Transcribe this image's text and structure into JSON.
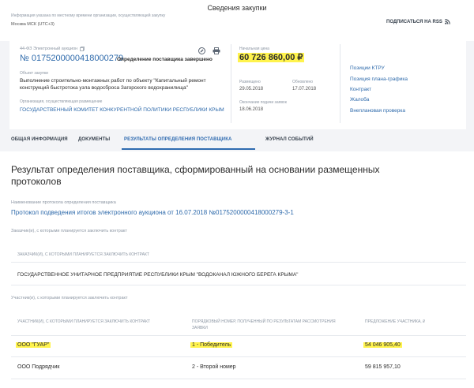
{
  "header": {
    "title": "Сведения закупки",
    "notice": "Информация указана по местному времени организации, осуществляющей закупку",
    "timezone": "Москва МСК (UTC+3)",
    "rss": "ПОДПИСАТЬСЯ НА RSS"
  },
  "procurement": {
    "law": "44-ФЗ Электронный аукцион",
    "number": "№ 0175200000418000279",
    "status": "Определение поставщика завершено",
    "object_label": "Объект закупки",
    "object_line1": "Выполнение строительно-монтажных работ по объекту \"Капитальный ремонт",
    "object_line2": "конструкций быстротока узла водосброса Загорского водохранилища\"",
    "org_label": "Организация, осуществляющая размещение",
    "org_name": "ГОСУДАРСТВЕННЫЙ КОМИТЕТ КОНКУРЕНТНОЙ ПОЛИТИКИ РЕСПУБЛИКИ КРЫМ",
    "price_label": "Начальная цена",
    "price": "60 726 860,00 ₽",
    "posted_label": "Размещено",
    "posted": "29.05.2018",
    "updated_label": "Обновлено",
    "updated": "17.07.2018",
    "deadline_label": "Окончание подачи заявок",
    "deadline": "18.06.2018"
  },
  "sidelinks": [
    "Позиции КТРУ",
    "Позиция плана-графика",
    "Контракт",
    "Жалоба",
    "Внеплановая проверка"
  ],
  "tabs": [
    "ОБЩАЯ ИНФОРМАЦИЯ",
    "ДОКУМЕНТЫ",
    "РЕЗУЛЬТАТЫ ОПРЕДЕЛЕНИЯ ПОСТАВЩИКА",
    "ЖУРНАЛ СОБЫТИЙ"
  ],
  "result": {
    "title_line1": "Результат определения поставщика, сформированный на основании размещенных",
    "title_line2": "протоколов",
    "protocol_label": "Наименование протокола определения поставщика",
    "protocol": "Протокол подведения итогов электронного аукциона от 16.07.2018 №0175200000418000279-3-1",
    "customers_label": "Заказчик(и), с которыми планируется заключить контракт",
    "customers_header": "ЗАКАЗЧИК(И), С КОТОРЫМИ ПЛАНИРУЕТСЯ ЗАКЛЮЧИТЬ КОНТРАКТ",
    "customer": "ГОСУДАРСТВЕННОЕ УНИТАРНОЕ ПРЕДПРИЯТИЕ РЕСПУБЛИКИ КРЫМ \"ВОДОКАНАЛ ЮЖНОГО БЕРЕГА КРЫМА\"",
    "participants_label": "Участник(и), с которыми планируется заключить контракт",
    "col1": "УЧАСТНИК(И), С КОТОРЫМИ ПЛАНИРУЕТСЯ ЗАКЛЮЧИТЬ КОНТРАКТ",
    "col2_line1": "ПОРЯДКОВЫЙ НОМЕР, ПОЛУЧЕННЫЙ ПО РЕЗУЛЬТАТАМ РАССМОТРЕНИЯ",
    "col2_line2": "ЗАЯВКИ",
    "col3": "ПРЕДЛОЖЕНИЕ УЧАСТНИКА, ₽",
    "rows": [
      {
        "name": "ООО \"ГУАР\"",
        "rank": "1 - Победитель",
        "offer": "54 046 905,40"
      },
      {
        "name": "ООО Подрядчик",
        "rank": "2 - Второй номер",
        "offer": "59 815 957,10"
      }
    ]
  }
}
